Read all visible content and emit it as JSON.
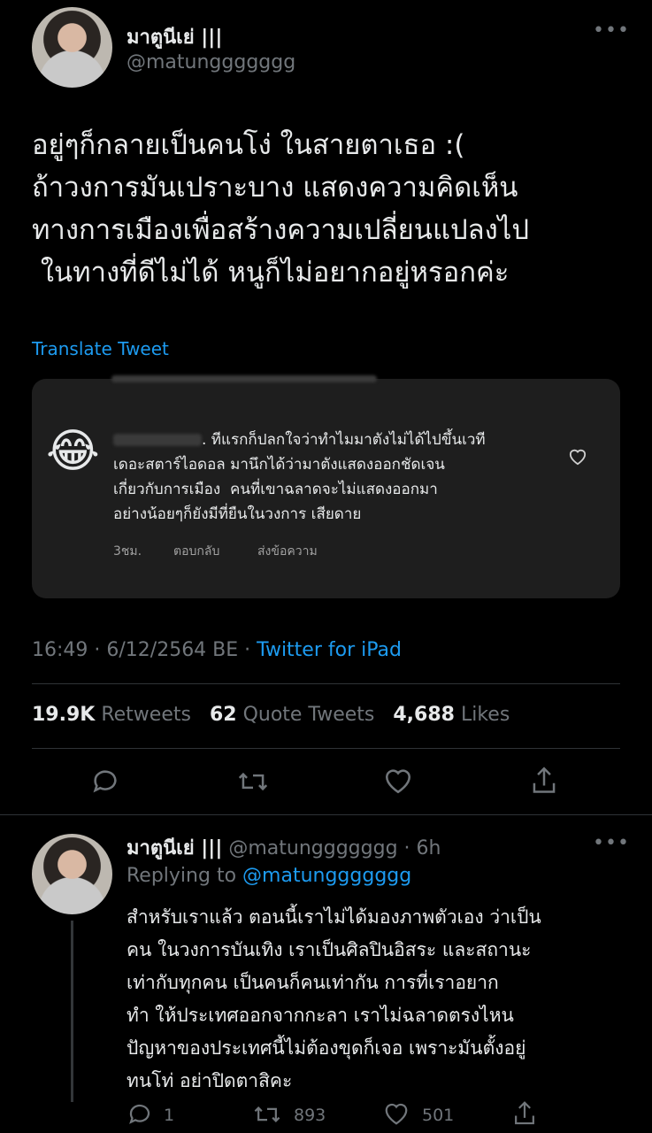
{
  "tweet": {
    "author_name": "มาตูนีเย่ |||",
    "author_handle": "@matunggggggg",
    "text_lines": [
      "อยู่ๆก็กลายเป็นคนโง่ ในสายตาเธอ :(",
      "ถ้าวงการมันเปราะบาง แสดงความคิดเห็น",
      "ทางการเมืองเพื่อสร้างความเปลี่ยนแปลงไป",
      " ในทางที่ดีไม่ได้ หนูก็ไม่อยากอยู่หรอกค่ะ"
    ],
    "translate_label": "Translate Tweet",
    "timestamp": "16:49 · 6/12/2564 BE · ",
    "source": "Twitter for iPad",
    "stats": {
      "retweets_count": "19.9K",
      "retweets_label": "Retweets",
      "quotes_count": "62",
      "quotes_label": "Quote Tweets",
      "likes_count": "4,688",
      "likes_label": "Likes"
    }
  },
  "embedded_comment": {
    "emoji": "😂",
    "lines": [
      ". ทีแรกก็ปลกใจว่าทำไมมาตังไม่ได้ไปขึ้นเวที",
      "เดอะสตาร์ไอดอล มานึกได้ว่ามาตังแสดงออกชัดเจน",
      "เกี่ยวกับการเมือง  คนที่เขาฉลาดจะไม่แสดงออกมา",
      "อย่างน้อยๆก็ยังมีที่ยืนในวงการ เสียดาย"
    ],
    "time": "3ชม.",
    "reply_label": "ตอบกลับ",
    "message_label": "ส่งข้อความ"
  },
  "reply": {
    "author_name": "มาตูนีเย่ |||",
    "author_handle": "@matunggggggg · 6h",
    "replying_prefix": "Replying to ",
    "replying_to": "@matunggggggg",
    "text_lines": [
      "สำหรับเราแล้ว ตอนนี้เราไม่ได้มองภาพตัวเอง ว่าเป็น",
      "คน ในวงการบันเทิง เราเป็นศิลปินอิสระ และสถานะ",
      "เท่ากับทุกคน เป็นคนก็คนเท่ากัน การที่เราอยาก",
      "ทำ ให้ประเทศออกจากกะลา เราไม่ฉลาดตรงไหน",
      "ปัญหาของประเทศนี้ไม่ต้องขุดก็เจอ เพราะมันตั้งอยู่",
      "ทนโท่ อย่าปิดตาสิคะ"
    ],
    "replies_count": "1",
    "retweets_count": "893",
    "likes_count": "501"
  },
  "icons": [
    "more-icon",
    "reply-icon",
    "retweet-icon",
    "like-icon",
    "share-icon",
    "heart-outline-icon"
  ],
  "colors": {
    "background": "#000000",
    "accent": "#1d9bf0",
    "muted": "#71767b",
    "card": "#1e1e1e"
  }
}
